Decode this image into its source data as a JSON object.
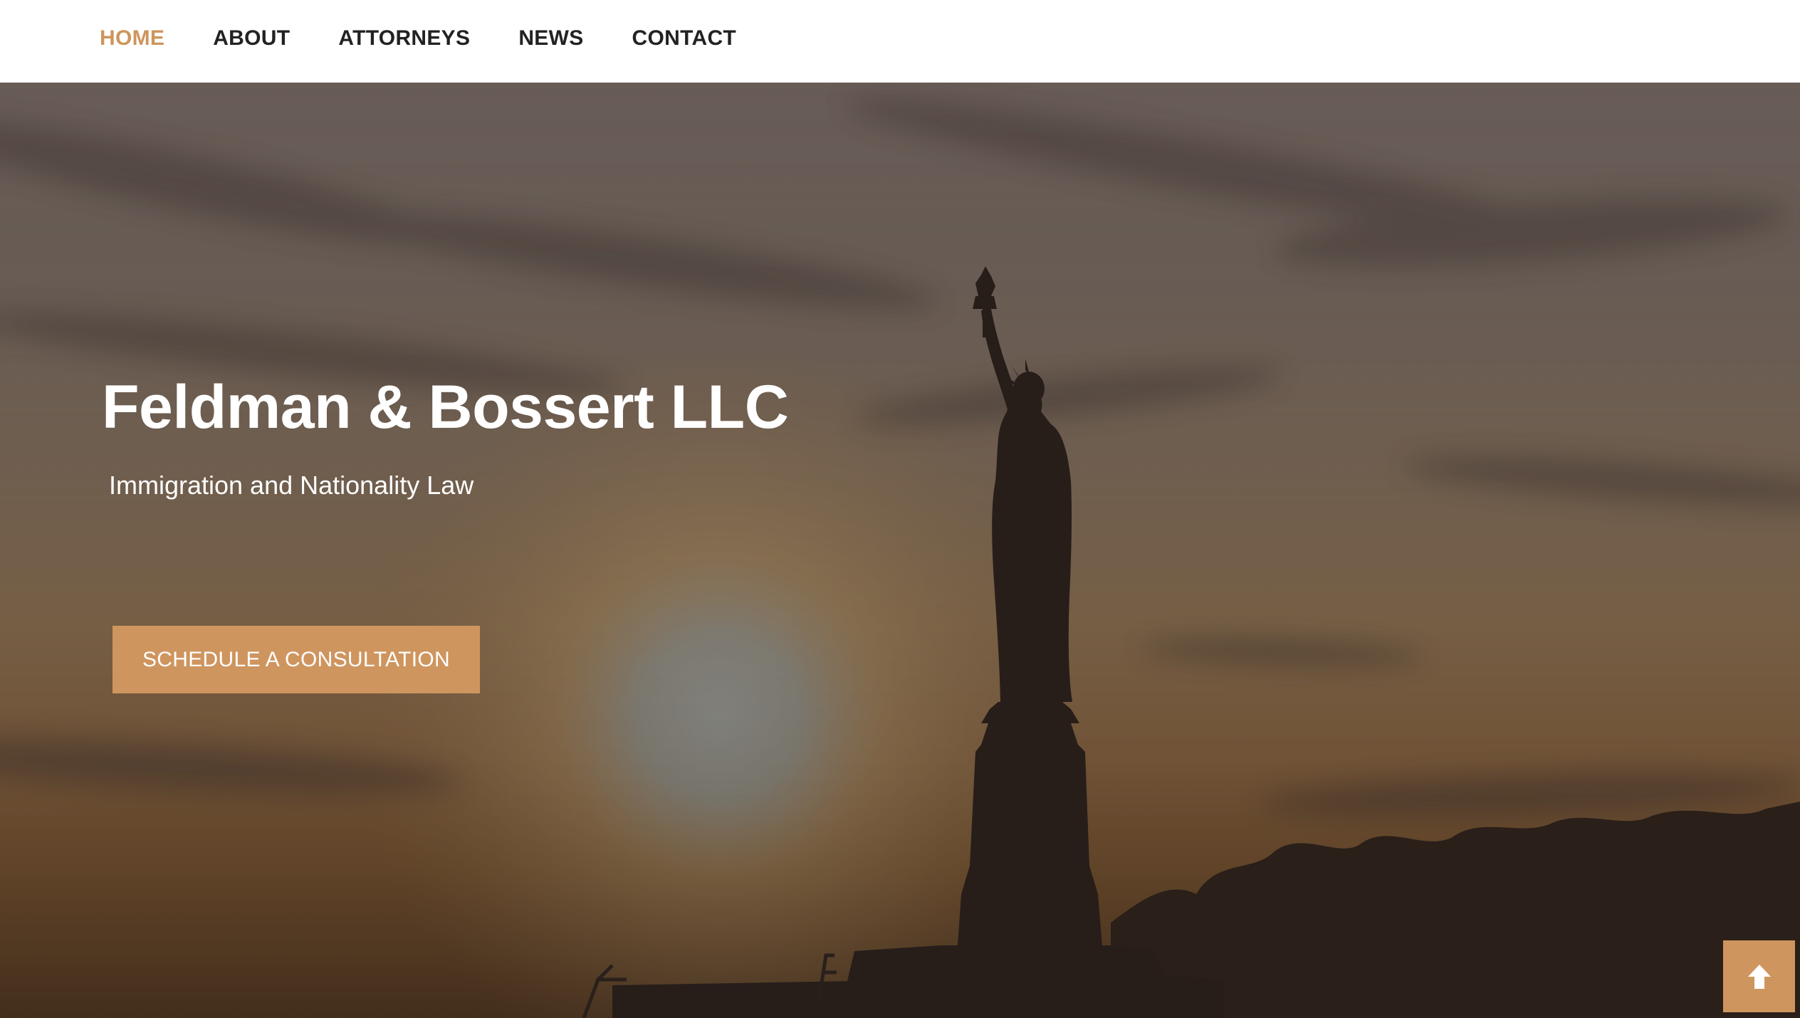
{
  "nav": {
    "items": [
      {
        "label": "HOME",
        "active": true
      },
      {
        "label": "ABOUT",
        "active": false
      },
      {
        "label": "ATTORNEYS",
        "active": false
      },
      {
        "label": "NEWS",
        "active": false
      },
      {
        "label": "CONTACT",
        "active": false
      }
    ],
    "active_color": "#cd955c",
    "text_color": "#222222"
  },
  "hero": {
    "title": "Feldman & Bossert LLC",
    "subtitle": "Immigration and Nationality Law",
    "cta_label": "SCHEDULE A CONSULTATION",
    "background_image": "statue-of-liberty-sunset-silhouette"
  },
  "scroll_top": {
    "icon": "arrow-up-icon"
  },
  "colors": {
    "accent": "#cf955e",
    "nav_background": "#ffffff",
    "hero_text": "#ffffff"
  }
}
